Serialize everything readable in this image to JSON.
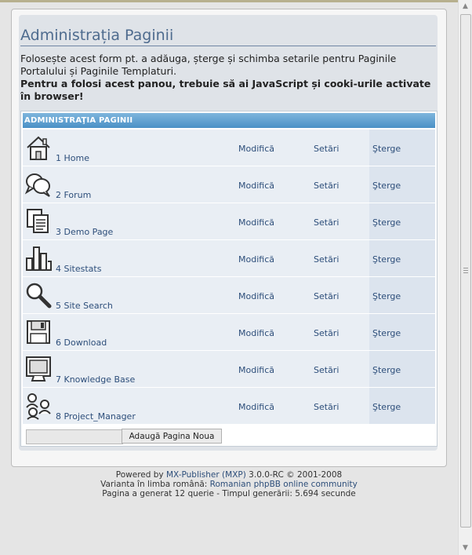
{
  "title": "Administrația Paginii",
  "description": "Folosește acest form pt. a adăuga, șterge și schimba setarile pentru Paginile Portalului și Paginile Templaturi.",
  "warning": "Pentru a folosi acest panou, trebuie să ai JavaScript și cooki-urile activate în browser!",
  "table_header": "ADMINISTRAŢIA PAGINII",
  "pages": [
    {
      "name": "1 Home",
      "icon": "home-icon"
    },
    {
      "name": "2 Forum",
      "icon": "forum-icon"
    },
    {
      "name": "3 Demo Page",
      "icon": "documents-icon"
    },
    {
      "name": "4 Sitestats",
      "icon": "stats-icon"
    },
    {
      "name": "5 Site Search",
      "icon": "search-icon"
    },
    {
      "name": "6 Download",
      "icon": "floppy-disk-icon"
    },
    {
      "name": "7 Knowledge Base",
      "icon": "monitor-icon"
    },
    {
      "name": "8 Project_Manager",
      "icon": "people-icon"
    }
  ],
  "actions": {
    "edit": "Modifică",
    "settings": "Setări",
    "delete": "Şterge"
  },
  "add_page": {
    "input_value": "",
    "button_label": "Adaugă Pagina Noua"
  },
  "footer": {
    "line1_prefix": "Powered by",
    "line1_link": "MX-Publisher (MXP)",
    "line1_suffix": "3.0.0-RC © 2001-2008",
    "line2_prefix": "Varianta în limba română:",
    "line2_link": "Romanian phpBB online community",
    "line3": "Pagina a generat 12 querie - Timpul generării: 5.694 secunde"
  },
  "colors": {
    "header_bar": "#4a90c6",
    "link": "#2d4e7a",
    "title": "#4e6b8e"
  }
}
